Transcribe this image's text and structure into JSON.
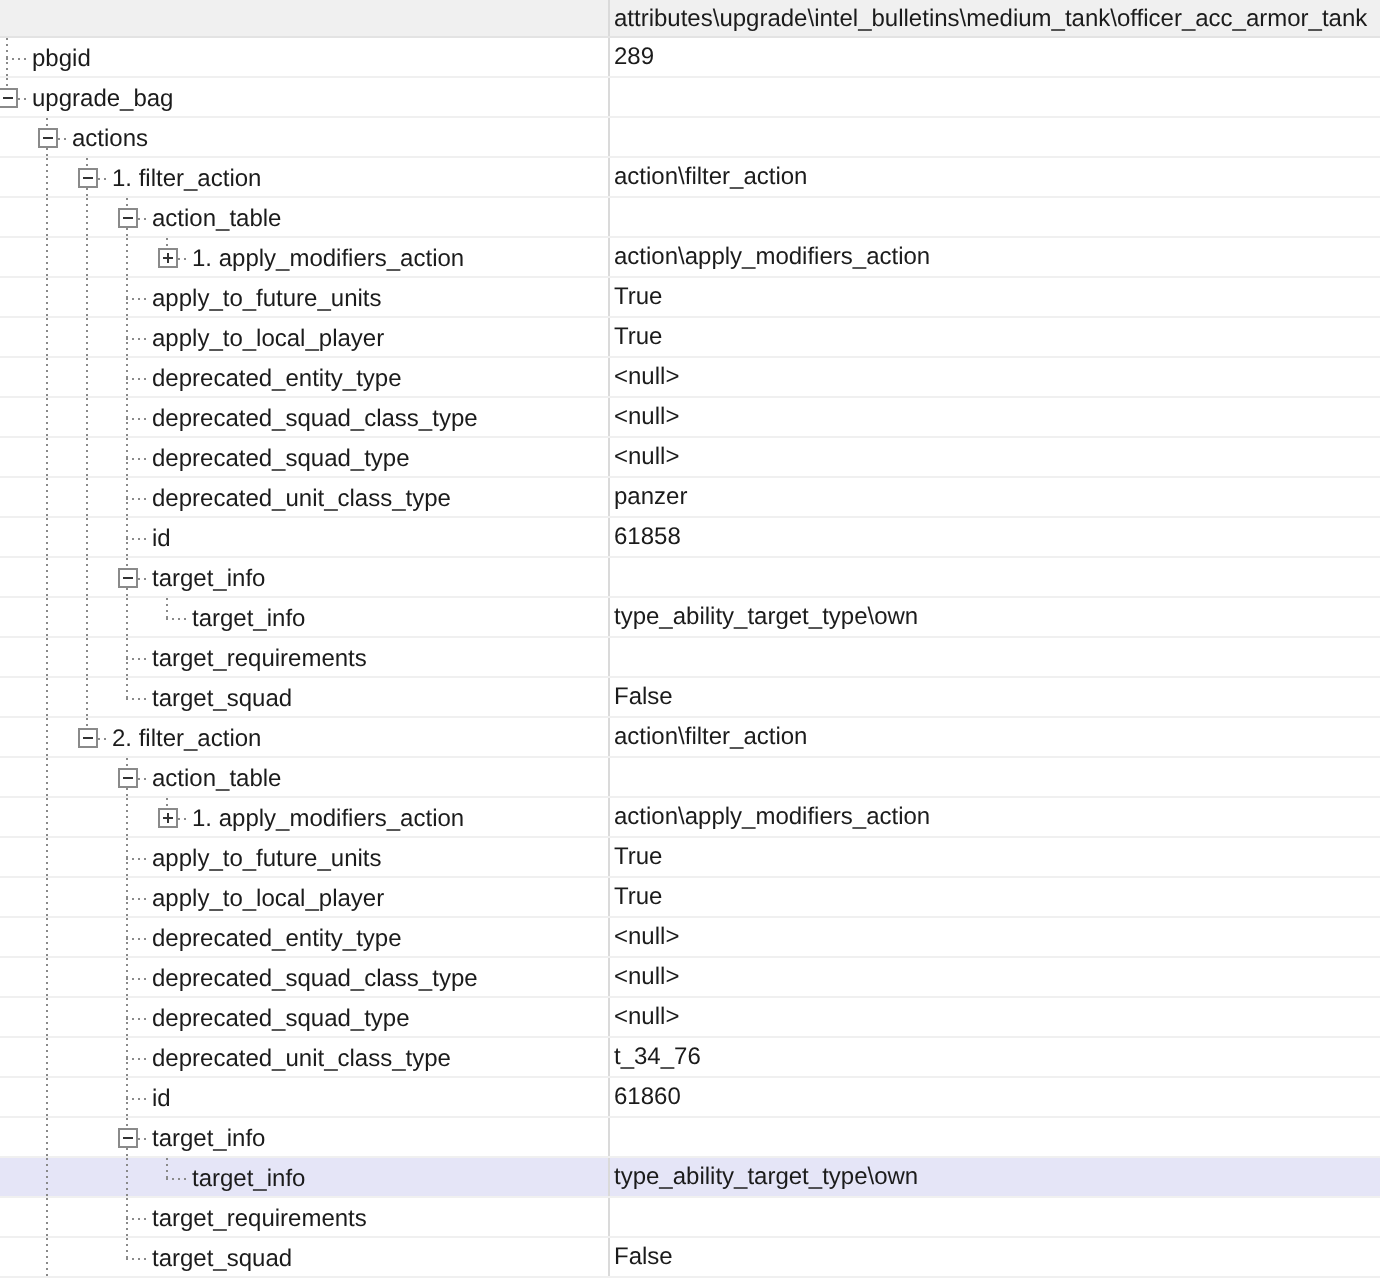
{
  "header": {
    "column_2": "attributes\\upgrade\\intel_bulletins\\medium_tank\\officer_acc_armor_tank"
  },
  "tree": [
    {
      "name": "pbgid",
      "value": "289",
      "selected": false
    },
    {
      "name": "upgrade_bag",
      "selected": false,
      "expanded": true,
      "children": [
        {
          "name": "actions",
          "selected": false,
          "expanded": true,
          "has_more_siblings": true,
          "children": [
            {
              "name": "1. filter_action",
              "value": "action\\filter_action",
              "selected": false,
              "expanded": true,
              "children": [
                {
                  "name": "action_table",
                  "selected": false,
                  "expanded": true,
                  "children": [
                    {
                      "name": "1. apply_modifiers_action",
                      "value": "action\\apply_modifiers_action",
                      "selected": false,
                      "expanded": false
                    }
                  ]
                },
                {
                  "name": "apply_to_future_units",
                  "value": "True",
                  "selected": false
                },
                {
                  "name": "apply_to_local_player",
                  "value": "True",
                  "selected": false
                },
                {
                  "name": "deprecated_entity_type",
                  "value": "<null>",
                  "selected": false
                },
                {
                  "name": "deprecated_squad_class_type",
                  "value": "<null>",
                  "selected": false
                },
                {
                  "name": "deprecated_squad_type",
                  "value": "<null>",
                  "selected": false
                },
                {
                  "name": "deprecated_unit_class_type",
                  "value": "panzer",
                  "selected": false
                },
                {
                  "name": "id",
                  "value": "61858",
                  "selected": false
                },
                {
                  "name": "target_info",
                  "selected": false,
                  "expanded": true,
                  "children": [
                    {
                      "name": "target_info",
                      "value": "type_ability_target_type\\own",
                      "selected": false
                    }
                  ]
                },
                {
                  "name": "target_requirements",
                  "selected": false
                },
                {
                  "name": "target_squad",
                  "value": "False",
                  "selected": false
                }
              ]
            },
            {
              "name": "2. filter_action",
              "value": "action\\filter_action",
              "selected": false,
              "expanded": true,
              "children": [
                {
                  "name": "action_table",
                  "selected": false,
                  "expanded": true,
                  "children": [
                    {
                      "name": "1. apply_modifiers_action",
                      "value": "action\\apply_modifiers_action",
                      "selected": false,
                      "expanded": false
                    }
                  ]
                },
                {
                  "name": "apply_to_future_units",
                  "value": "True",
                  "selected": false
                },
                {
                  "name": "apply_to_local_player",
                  "value": "True",
                  "selected": false
                },
                {
                  "name": "deprecated_entity_type",
                  "value": "<null>",
                  "selected": false
                },
                {
                  "name": "deprecated_squad_class_type",
                  "value": "<null>",
                  "selected": false
                },
                {
                  "name": "deprecated_squad_type",
                  "value": "<null>",
                  "selected": false
                },
                {
                  "name": "deprecated_unit_class_type",
                  "value": "t_34_76",
                  "selected": false
                },
                {
                  "name": "id",
                  "value": "61860",
                  "selected": false
                },
                {
                  "name": "target_info",
                  "selected": false,
                  "expanded": true,
                  "children": [
                    {
                      "name": "target_info",
                      "value": "type_ability_target_type\\own",
                      "selected": true
                    }
                  ]
                },
                {
                  "name": "target_requirements",
                  "selected": false
                },
                {
                  "name": "target_squad",
                  "value": "False",
                  "selected": false
                }
              ]
            }
          ]
        }
      ]
    }
  ]
}
